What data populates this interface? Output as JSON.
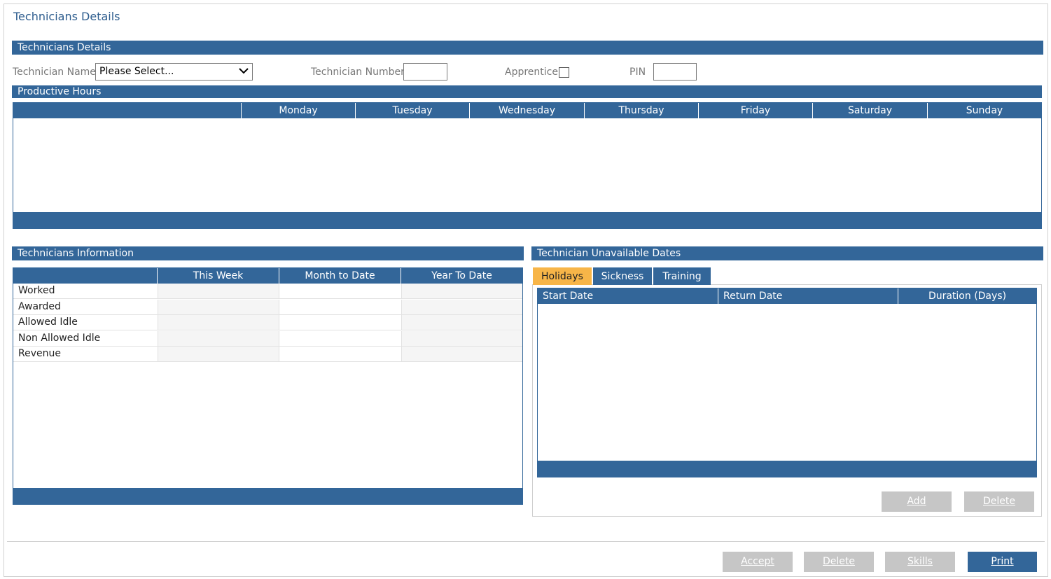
{
  "page": {
    "title": "Technicians Details"
  },
  "details": {
    "section_title": "Technicians Details",
    "technician_name_label": "Technician Name",
    "technician_name_value": "Please Select...",
    "technician_number_label": "Technician Number",
    "apprentice_label": "Apprentice",
    "pin_label": "PIN"
  },
  "productive_hours": {
    "section_title": "Productive Hours",
    "days": [
      "Monday",
      "Tuesday",
      "Wednesday",
      "Thursday",
      "Friday",
      "Saturday",
      "Sunday"
    ]
  },
  "info": {
    "section_title": "Technicians Information",
    "columns": [
      "This Week",
      "Month to Date",
      "Year To Date"
    ],
    "rows": [
      "Worked",
      "Awarded",
      "Allowed Idle",
      "Non Allowed Idle",
      "Revenue"
    ]
  },
  "unavailable": {
    "section_title": "Technician Unavailable Dates",
    "tabs": [
      "Holidays",
      "Sickness",
      "Training"
    ],
    "active_tab": "Holidays",
    "columns": [
      "Start Date",
      "Return Date",
      "Duration (Days)"
    ],
    "add_label": "Add",
    "delete_label": "Delete"
  },
  "footer": {
    "accept_label": "Accept",
    "delete_label": "Delete",
    "skills_label": "Skills",
    "print_label": "Print"
  },
  "colors": {
    "header_blue": "#336699",
    "active_tab": "#f7b548",
    "disabled_button": "#c6c6c6"
  },
  "icons": {
    "dropdown": "chevron-down-icon"
  }
}
